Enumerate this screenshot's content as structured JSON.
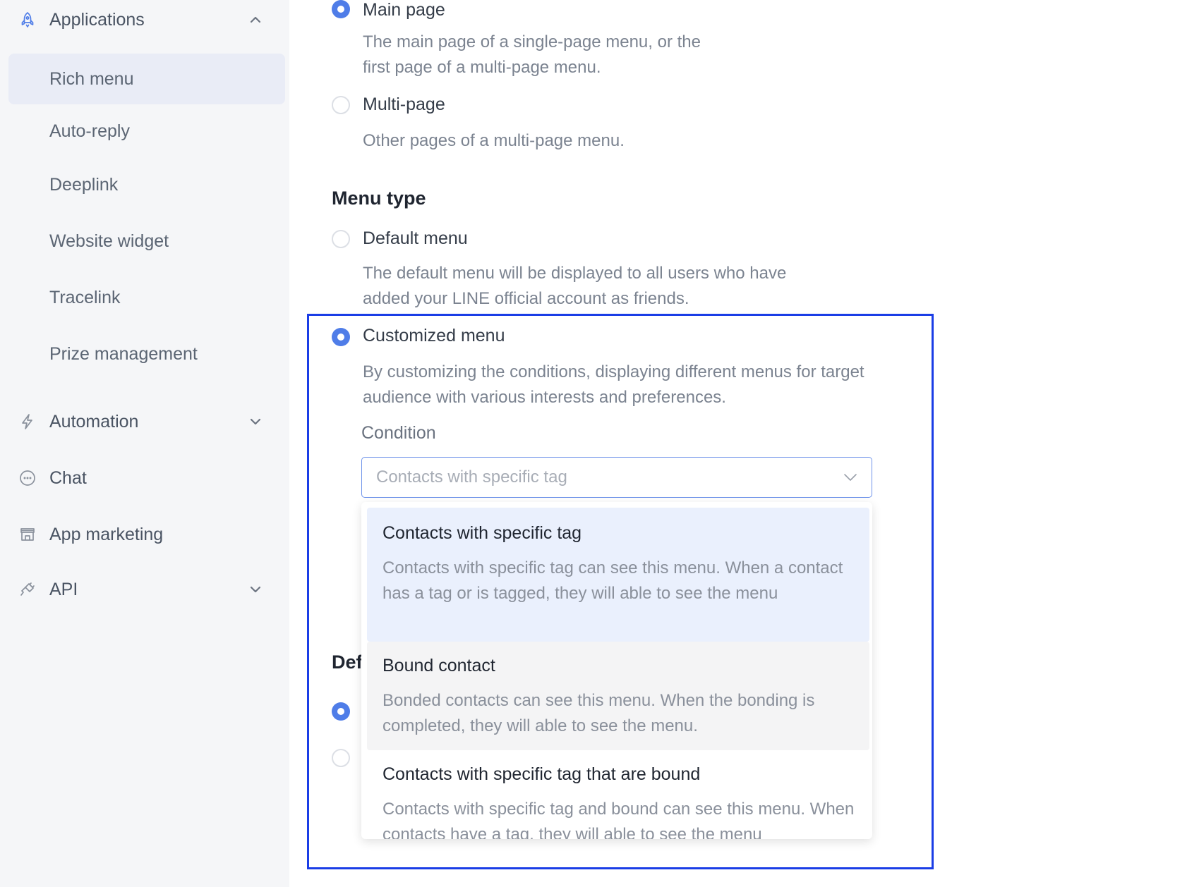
{
  "sidebar": {
    "groups": [
      {
        "label": "Applications",
        "icon": "rocket-icon",
        "expanded": true
      },
      {
        "label": "Automation",
        "icon": "lightning-icon",
        "expanded": false
      },
      {
        "label": "Chat",
        "icon": "chat-bubble-icon"
      },
      {
        "label": "App marketing",
        "icon": "store-icon"
      },
      {
        "label": "API",
        "icon": "plug-icon",
        "expanded": false
      }
    ],
    "items": [
      {
        "label": "Rich menu",
        "active": true
      },
      {
        "label": "Auto-reply"
      },
      {
        "label": "Deeplink"
      },
      {
        "label": "Website widget"
      },
      {
        "label": "Tracelink"
      },
      {
        "label": "Prize management"
      }
    ]
  },
  "page_type": {
    "options": [
      {
        "label": "Main page",
        "description": "The main page of a single-page menu, or the first page of a multi-page menu.",
        "selected": true
      },
      {
        "label": "Multi-page",
        "description": "Other pages of a multi-page menu.",
        "selected": false
      }
    ]
  },
  "menu_type": {
    "title": "Menu type",
    "options": [
      {
        "label": "Default menu",
        "description": "The default menu will be displayed to all users who have added your LINE official account as friends.",
        "selected": false
      },
      {
        "label": "Customized menu",
        "description": "By customizing the conditions, displaying different menus for target audience with various interests and preferences.",
        "selected": true
      }
    ],
    "condition_label": "Condition",
    "condition_placeholder": "Contacts with specific tag",
    "condition_options": [
      {
        "title": "Contacts with specific tag",
        "description": "Contacts with specific tag can see this menu. When a contact has a tag or is tagged, they will able to see the menu",
        "state": "selected"
      },
      {
        "title": "Bound contact",
        "description": "Bonded contacts can see this menu. When the bonding is completed, they will able to see the menu.",
        "state": "hover"
      },
      {
        "title": "Contacts with specific tag that are bound",
        "description": "Contacts with specific tag and bound can see this menu. When contacts have a tag, they will able to see the menu",
        "state": "normal"
      }
    ]
  },
  "obscured_section": {
    "title_fragment": "Def"
  },
  "colors": {
    "accent": "#4f7de8",
    "highlight_border": "#1a3de6",
    "sidebar_bg": "#f5f6f8",
    "active_item_bg": "#e9ecf6",
    "selected_option_bg": "#eaf0fd",
    "hover_option_bg": "#f4f4f5"
  }
}
